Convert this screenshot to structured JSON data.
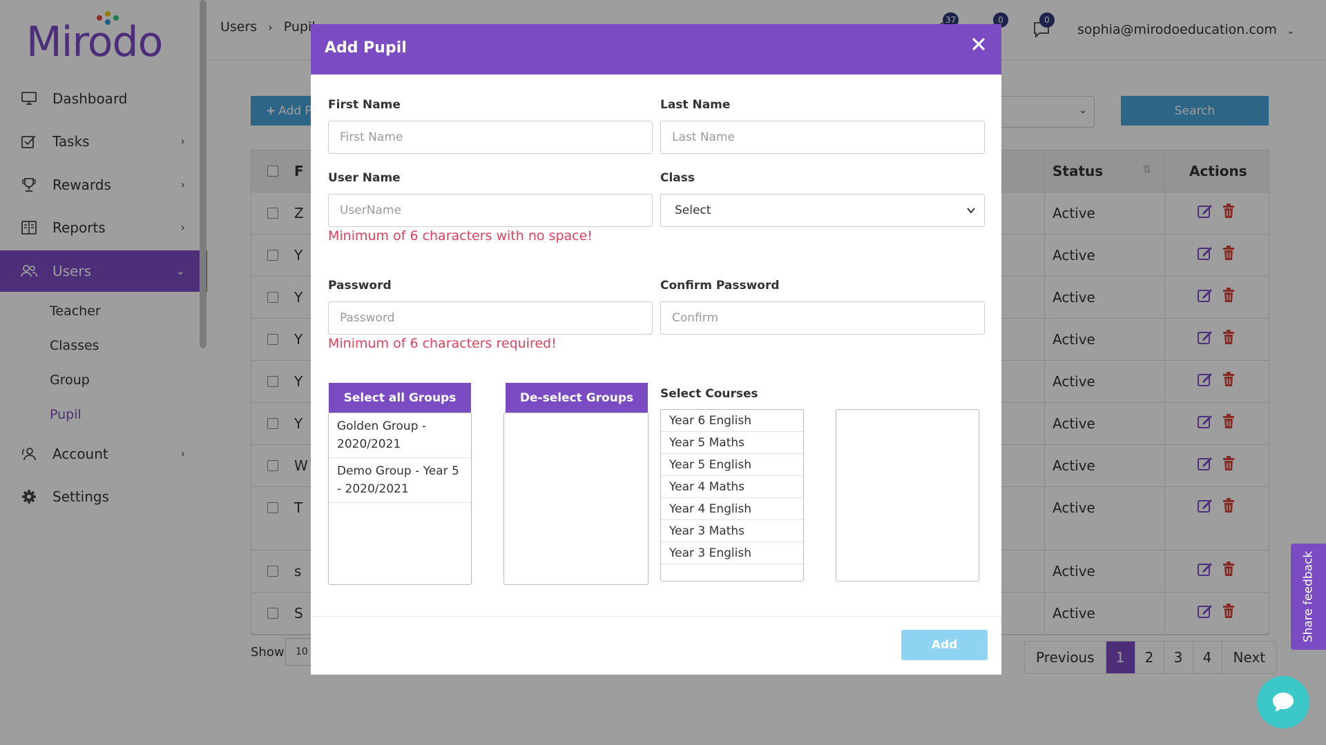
{
  "app": {
    "logo_text": "Mirodo"
  },
  "sidebar": {
    "items": [
      {
        "label": "Dashboard",
        "icon": "monitor-icon"
      },
      {
        "label": "Tasks",
        "icon": "tasks-icon"
      },
      {
        "label": "Rewards",
        "icon": "trophy-icon"
      },
      {
        "label": "Reports",
        "icon": "reports-icon"
      },
      {
        "label": "Users",
        "icon": "users-icon"
      },
      {
        "label": "Account",
        "icon": "account-icon"
      },
      {
        "label": "Settings",
        "icon": "gear-icon"
      }
    ],
    "sub_items": [
      "Teacher",
      "Classes",
      "Group",
      "Pupil"
    ]
  },
  "topbar": {
    "breadcrumb_root": "Users",
    "breadcrumb_current": "Pupil",
    "badges": {
      "notifications": "37",
      "alerts": "0",
      "messages": "0"
    },
    "user_email": "sophia@mirodoeducation.com"
  },
  "toolbar": {
    "add_label": "Add P",
    "search_label": "Search"
  },
  "table": {
    "headers": {
      "first": "F",
      "status": "Status",
      "actions": "Actions"
    },
    "rows": [
      {
        "first": "Z",
        "status": "Active"
      },
      {
        "first": "Y",
        "status": "Active"
      },
      {
        "first": "Y",
        "status": "Active"
      },
      {
        "first": "Y",
        "status": "Active"
      },
      {
        "first": "Y",
        "status": "Active"
      },
      {
        "first": "Y",
        "status": "Active"
      },
      {
        "first": "W",
        "status": "Active"
      },
      {
        "first": "T",
        "status": "Active"
      },
      {
        "first": "s",
        "status": "Active"
      },
      {
        "first": "S",
        "status": "Active"
      }
    ]
  },
  "footer": {
    "show_label": "Show",
    "show_value": "10",
    "pagination": {
      "previous": "Previous",
      "pages": [
        "1",
        "2",
        "3",
        "4"
      ],
      "next": "Next",
      "current": "1"
    }
  },
  "feedback_label": "Share feedback",
  "modal": {
    "title": "Add Pupil",
    "first_name": {
      "label": "First Name",
      "placeholder": "First Name"
    },
    "last_name": {
      "label": "Last Name",
      "placeholder": "Last Name"
    },
    "user_name": {
      "label": "User Name",
      "placeholder": "UserName",
      "error": "Minimum of 6 characters with no space!"
    },
    "class": {
      "label": "Class",
      "value": "Select"
    },
    "password": {
      "label": "Password",
      "placeholder": "Password",
      "error": "Minimum of 6 characters required!"
    },
    "confirm_password": {
      "label": "Confirm Password",
      "placeholder": "Confirm"
    },
    "select_all_groups": "Select all Groups",
    "deselect_groups": "De-select Groups",
    "groups": [
      "Golden Group - 2020/2021",
      "Demo Group - Year 5 - 2020/2021"
    ],
    "courses_label": "Select Courses",
    "courses": [
      "Year 6 English",
      "Year 5 Maths",
      "Year 5 English",
      "Year 4 Maths",
      "Year 4 English",
      "Year 3 Maths",
      "Year 3 English"
    ],
    "add_button": "Add"
  },
  "colors": {
    "brand": "#7b4bc4",
    "info": "#4aa3d8",
    "error": "#e0405a",
    "add_disabled": "#8fd3f2"
  }
}
